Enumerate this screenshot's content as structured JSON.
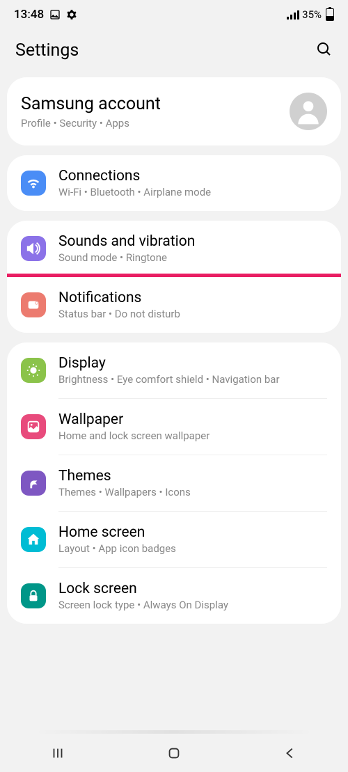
{
  "status": {
    "time": "13:48",
    "battery": "35%"
  },
  "header": {
    "title": "Settings"
  },
  "account": {
    "title": "Samsung account",
    "subtitle": "Profile  •  Security  •  Apps"
  },
  "groups": [
    {
      "items": [
        {
          "title": "Connections",
          "subtitle": "Wi-Fi  •  Bluetooth  •  Airplane mode",
          "icon": "wifi"
        }
      ]
    },
    {
      "items": [
        {
          "title": "Sounds and vibration",
          "subtitle": "Sound mode  •  Ringtone",
          "icon": "sound"
        },
        {
          "title": "Notifications",
          "subtitle": "Status bar  •  Do not disturb",
          "icon": "notification",
          "highlighted": true
        }
      ]
    },
    {
      "items": [
        {
          "title": "Display",
          "subtitle": "Brightness  •  Eye comfort shield  •  Navigation bar",
          "icon": "display"
        },
        {
          "title": "Wallpaper",
          "subtitle": "Home and lock screen wallpaper",
          "icon": "wallpaper"
        },
        {
          "title": "Themes",
          "subtitle": "Themes  •  Wallpapers  •  Icons",
          "icon": "themes"
        },
        {
          "title": "Home screen",
          "subtitle": "Layout  •  App icon badges",
          "icon": "home"
        },
        {
          "title": "Lock screen",
          "subtitle": "Screen lock type  •  Always On Display",
          "icon": "lock"
        }
      ]
    }
  ]
}
